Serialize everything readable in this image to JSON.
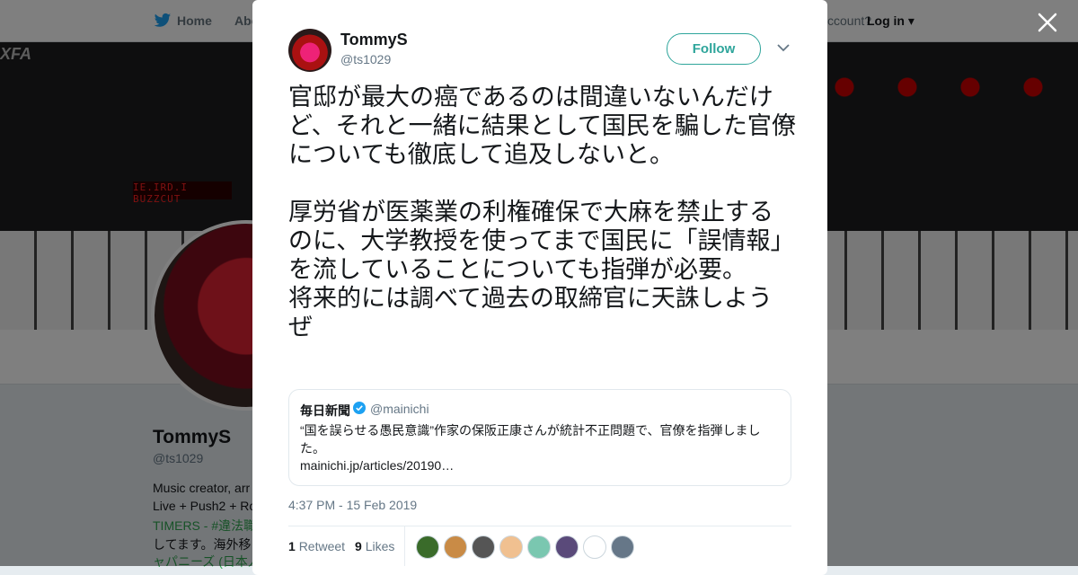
{
  "nav": {
    "home": "Home",
    "about": "Abo",
    "account": "ccount?",
    "login": "Log in"
  },
  "banner": {
    "logo": "XFA",
    "lcd": "IE.IRD.I BUZZCUT"
  },
  "profile": {
    "name": "TommyS",
    "handle": "@ts1029",
    "bio": [
      "Music creator, arr",
      "Live + Push2 + Ro",
      "TIMERS - #違法職",
      "してます。海外移",
      "ャパニーズ (日本人"
    ]
  },
  "tweet": {
    "author_name": "TommyS",
    "author_handle": "@ts1029",
    "follow_label": "Follow",
    "text_paragraph1": "官邸が最大の癌であるのは間違いないんだけど、それと一緒に結果として国民を騙した官僚についても徹底して追及しないと。",
    "text_paragraph2": "厚労省が医薬業の利権確保で大麻を禁止するのに、大学教授を使ってまで国民に「誤情報」を流していることについても指弾が必要。",
    "text_paragraph3": "将来的には調べて過去の取締官に天誅しようぜ",
    "quote": {
      "name": "毎日新聞",
      "handle": "@mainichi",
      "text": "“国を誤らせる愚民意識”作家の保阪正康さんが統計不正問題で、官僚を指弾しました。",
      "link": "mainichi.jp/articles/20190…"
    },
    "timestamp": "4:37 PM - 15 Feb 2019",
    "retweet_count": "1",
    "retweet_label": "Retweet",
    "like_count": "9",
    "like_label": "Likes"
  },
  "likers": [
    {
      "color": "#3a6b2a"
    },
    {
      "color": "#c98b46"
    },
    {
      "color": "#555555"
    },
    {
      "color": "#f0c090"
    },
    {
      "color": "#7ac7b0"
    },
    {
      "color": "#5a4a7a"
    },
    {
      "color": "#ffffff"
    },
    {
      "color": "#667788"
    }
  ],
  "colors": {
    "accent": "#2ea59b",
    "link_green": "#2ea44f",
    "overlay": "rgba(0,0,0,0.5)"
  }
}
